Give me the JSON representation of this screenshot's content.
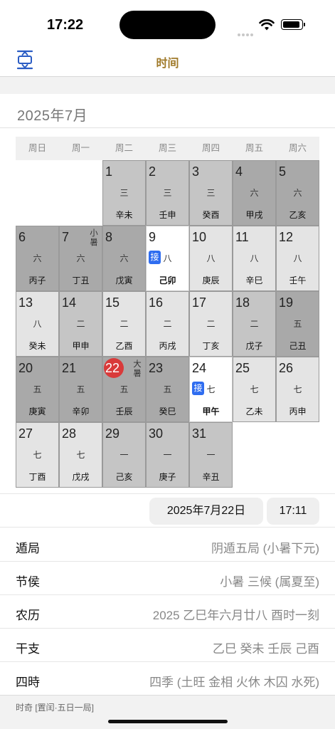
{
  "status_bar": {
    "time": "17:22"
  },
  "nav": {
    "title": "时间",
    "left_icon": "vertical-expand-icon"
  },
  "calendar": {
    "month_title": "2025年7月",
    "weekdays": [
      "周日",
      "周一",
      "周二",
      "周三",
      "周四",
      "周五",
      "周六"
    ],
    "days": [
      {
        "day": "1",
        "term_number": "三",
        "ganzhi": "辛未"
      },
      {
        "day": "2",
        "term_number": "三",
        "ganzhi": "壬申"
      },
      {
        "day": "3",
        "term_number": "三",
        "ganzhi": "癸酉"
      },
      {
        "day": "4",
        "term_number": "六",
        "ganzhi": "甲戌"
      },
      {
        "day": "5",
        "term_number": "六",
        "ganzhi": "乙亥"
      },
      {
        "day": "6",
        "term_number": "六",
        "ganzhi": "丙子"
      },
      {
        "day": "7",
        "term_number": "六",
        "ganzhi": "丁丑",
        "solar_term": "小暑"
      },
      {
        "day": "8",
        "term_number": "六",
        "ganzhi": "戊寅"
      },
      {
        "day": "9",
        "term_number": "八",
        "ganzhi": "己卯",
        "badge": "接"
      },
      {
        "day": "10",
        "term_number": "八",
        "ganzhi": "庚辰"
      },
      {
        "day": "11",
        "term_number": "八",
        "ganzhi": "辛巳"
      },
      {
        "day": "12",
        "term_number": "八",
        "ganzhi": "壬午"
      },
      {
        "day": "13",
        "term_number": "八",
        "ganzhi": "癸未"
      },
      {
        "day": "14",
        "term_number": "二",
        "ganzhi": "甲申"
      },
      {
        "day": "15",
        "term_number": "二",
        "ganzhi": "乙酉"
      },
      {
        "day": "16",
        "term_number": "二",
        "ganzhi": "丙戌"
      },
      {
        "day": "17",
        "term_number": "二",
        "ganzhi": "丁亥"
      },
      {
        "day": "18",
        "term_number": "二",
        "ganzhi": "戊子"
      },
      {
        "day": "19",
        "term_number": "五",
        "ganzhi": "己丑"
      },
      {
        "day": "20",
        "term_number": "五",
        "ganzhi": "庚寅"
      },
      {
        "day": "21",
        "term_number": "五",
        "ganzhi": "辛卯"
      },
      {
        "day": "22",
        "term_number": "五",
        "ganzhi": "壬辰",
        "solar_term": "大暑",
        "today": true
      },
      {
        "day": "23",
        "term_number": "五",
        "ganzhi": "癸巳"
      },
      {
        "day": "24",
        "term_number": "七",
        "ganzhi": "甲午",
        "badge": "接"
      },
      {
        "day": "25",
        "term_number": "七",
        "ganzhi": "乙未"
      },
      {
        "day": "26",
        "term_number": "七",
        "ganzhi": "丙申"
      },
      {
        "day": "27",
        "term_number": "七",
        "ganzhi": "丁酉"
      },
      {
        "day": "28",
        "term_number": "七",
        "ganzhi": "戊戌"
      },
      {
        "day": "29",
        "term_number": "一",
        "ganzhi": "己亥"
      },
      {
        "day": "30",
        "term_number": "一",
        "ganzhi": "庚子"
      },
      {
        "day": "31",
        "term_number": "一",
        "ganzhi": "辛丑"
      }
    ]
  },
  "picker": {
    "date": "2025年7月22日",
    "time": "17:11"
  },
  "info": [
    {
      "label": "遁局",
      "value": "阴遁五局 (小暑下元)"
    },
    {
      "label": "节侯",
      "value": "小暑 三候 (属夏至)"
    },
    {
      "label": "农历",
      "value": "2025 乙巳年六月廿八 酉时一刻"
    },
    {
      "label": "干支",
      "value": "乙巳 癸未 壬辰 己酉"
    },
    {
      "label": "四時",
      "value": "四季 (土旺 金相 火休 木囚 水死)"
    }
  ],
  "footer": {
    "text": "时奇 [置闰·五日一局]"
  },
  "colors": {
    "accent_gold": "#a07a2a",
    "today_red": "#d93a3a",
    "badge_blue": "#2f6df0"
  }
}
